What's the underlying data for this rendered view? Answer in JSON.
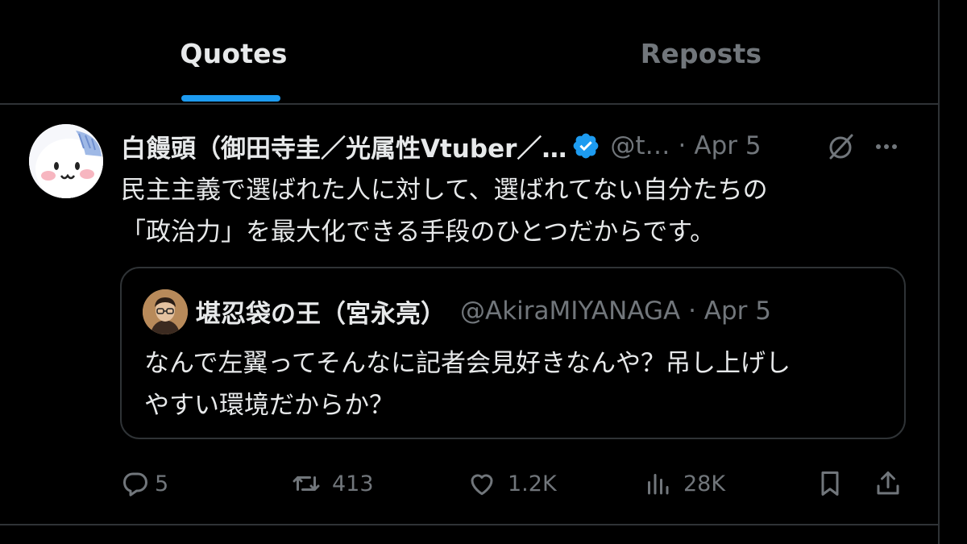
{
  "tabs": [
    {
      "label": "Quotes",
      "active": true
    },
    {
      "label": "Reposts",
      "active": false
    }
  ],
  "accent_color": "#1d9bf0",
  "post": {
    "display_name": "白饅頭（御田寺圭／光属性Vtuber／…",
    "handle": "@t…",
    "separator": "·",
    "date": "Apr 5",
    "text_lines": [
      "民主主義で選ばれた人に対して、選ばれてない自分たちの",
      "「政治力」を最大化できる手段のひとつだからです。"
    ],
    "icons": {
      "verified": "verified-badge-icon",
      "grok": "grok-icon",
      "more": "more-icon"
    },
    "quote": {
      "display_name": "堪忍袋の王（宮永亮）",
      "handle_date": "@AkiraMIYANAGA · Apr 5",
      "text_lines": [
        "なんで左翼ってそんなに記者会見好きなんや？吊し上げし",
        "やすい環境だからか？"
      ]
    },
    "actions": {
      "replies": "5",
      "reposts": "413",
      "likes": "1.2K",
      "views": "28K"
    }
  }
}
